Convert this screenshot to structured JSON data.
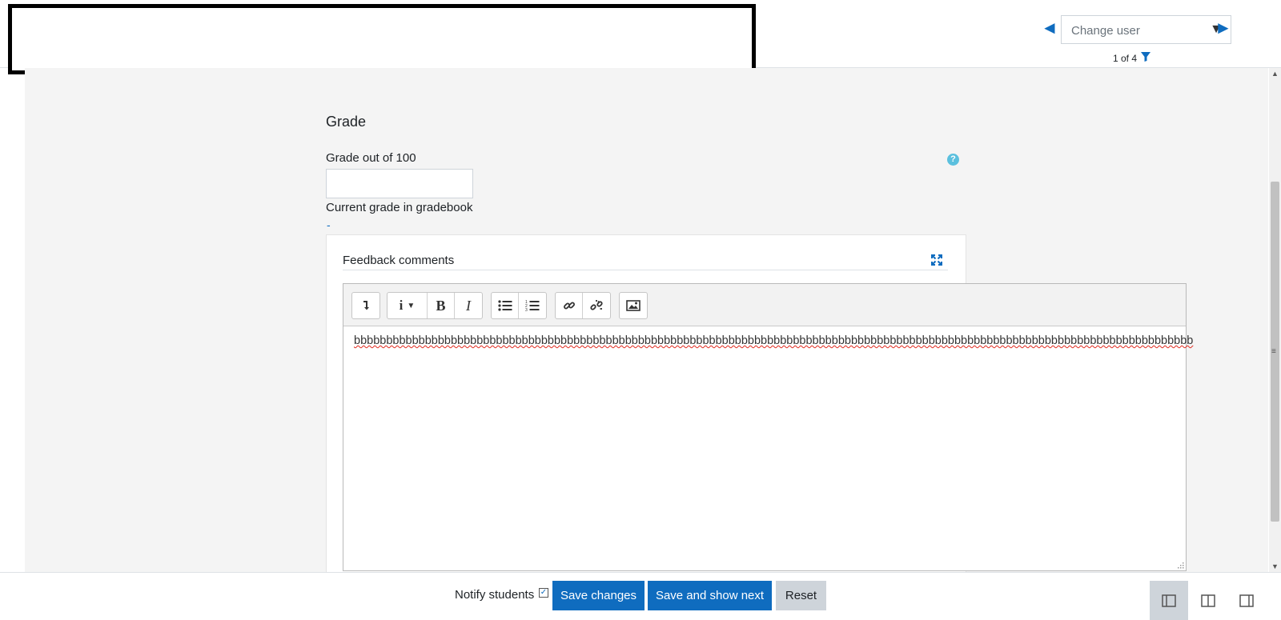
{
  "header": {
    "prev_icon": "triangle-left-icon",
    "next_icon": "triangle-right-icon",
    "change_user_placeholder": "Change user",
    "counter": "1 of 4",
    "filter_icon": "filter-icon"
  },
  "grade": {
    "heading": "Grade",
    "grade_label": "Grade out of 100",
    "grade_value": "",
    "current_label": "Current grade in gradebook",
    "current_value": "-"
  },
  "feedback": {
    "title": "Feedback comments",
    "toolbar": [
      {
        "name": "show-more-buttons",
        "icon": "arrow-down-icon"
      },
      {
        "name": "paragraph-styles",
        "icon": "info-icon"
      },
      {
        "name": "bold",
        "icon": "bold-icon"
      },
      {
        "name": "italic",
        "icon": "italic-icon"
      },
      {
        "name": "unordered-list",
        "icon": "bullet-list-icon"
      },
      {
        "name": "ordered-list",
        "icon": "numbered-list-icon"
      },
      {
        "name": "link",
        "icon": "link-icon"
      },
      {
        "name": "unlink",
        "icon": "unlink-icon"
      },
      {
        "name": "image",
        "icon": "image-icon"
      }
    ],
    "text": "bbbbbbbbbbbbbbbbbbbbbbbbbbbbbbbbbbbbbbbbbbbbbbbbbbbbbbbbbbbbbbbbbbbbbbbbbbbbbbbbbbbbbbbbbbbbbbbbbbbbbbbbbbbbbbbbbbbbbbbbbbbbbbbbbb"
  },
  "footer": {
    "notify_label": "Notify students",
    "notify_checked": true,
    "save_label": "Save changes",
    "save_next_label": "Save and show next",
    "reset_label": "Reset"
  },
  "colors": {
    "primary": "#0f6cbf",
    "background": "#f4f4f4",
    "help": "#5bc0de"
  }
}
